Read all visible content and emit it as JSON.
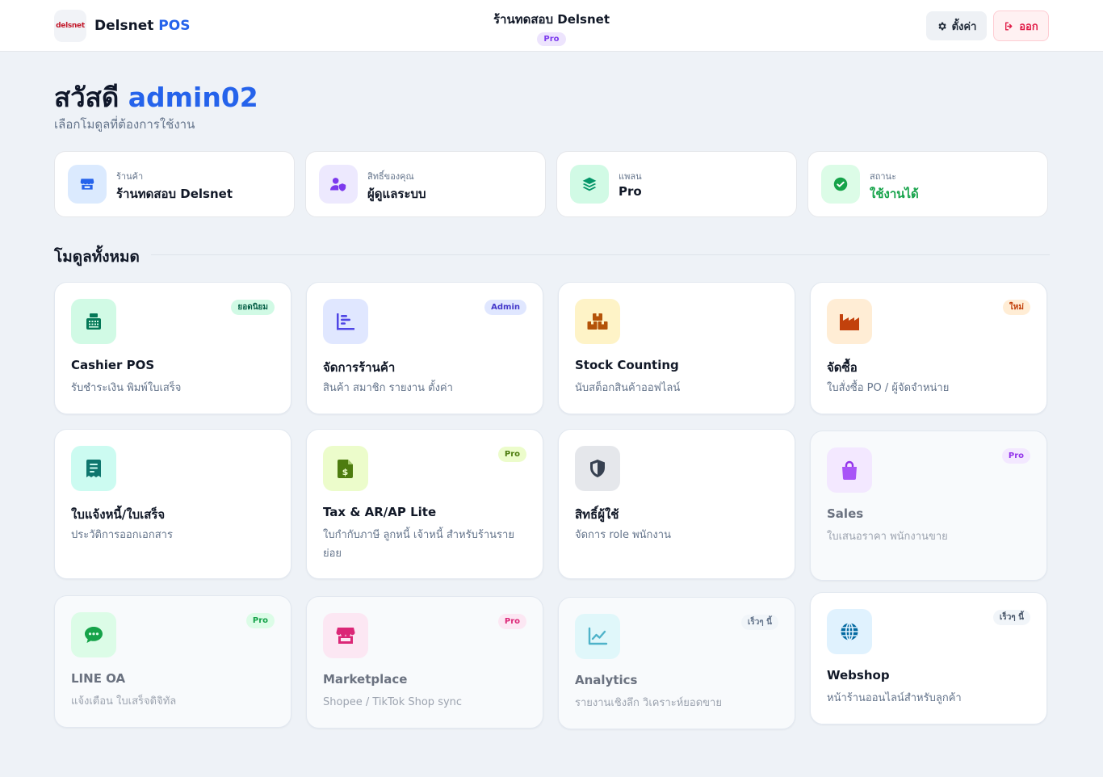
{
  "header": {
    "logo_text": "delsnet",
    "brand_name": "Delsnet",
    "brand_accent": "POS",
    "store_name": "ร้านทดสอบ Delsnet",
    "plan_badge": "Pro",
    "settings_label": "ตั้งค่า",
    "logout_label": "ออก"
  },
  "greeting": {
    "prefix": "สวัสดี",
    "username": "admin02",
    "subtitle": "เลือกโมดูลที่ต้องการใช้งาน"
  },
  "info_cards": [
    {
      "label": "ร้านค้า",
      "value": "ร้านทดสอบ Delsnet",
      "icon": "store-icon",
      "color": "#2563eb"
    },
    {
      "label": "สิทธิ์ของคุณ",
      "value": "ผู้ดูแลระบบ",
      "icon": "user-shield-icon",
      "color": "#7c3aed"
    },
    {
      "label": "แพลน",
      "value": "Pro",
      "icon": "layers-icon",
      "color": "#059669"
    },
    {
      "label": "สถานะ",
      "value": "ใช้งานได้",
      "icon": "check-circle-icon",
      "color": "#16a34a"
    }
  ],
  "section_title": "โมดูลทั้งหมด",
  "modules": [
    {
      "title": "Cashier POS",
      "desc": "รับชำระเงิน พิมพ์ใบเสร็จ",
      "badge": "ยอดนิยม",
      "icon": "cash-register-icon"
    },
    {
      "title": "จัดการร้านค้า",
      "desc": "สินค้า สมาชิก รายงาน ตั้งค่า",
      "badge": "Admin",
      "icon": "chart-bars-icon"
    },
    {
      "title": "Stock Counting",
      "desc": "นับสต็อกสินค้าออฟไลน์",
      "badge": "",
      "icon": "boxes-icon"
    },
    {
      "title": "จัดซื้อ",
      "desc": "ใบสั่งซื้อ PO / ผู้จัดจำหน่าย",
      "badge": "ใหม่",
      "icon": "factory-icon"
    },
    {
      "title": "ใบแจ้งหนี้/ใบเสร็จ",
      "desc": "ประวัติการออกเอกสาร",
      "badge": "",
      "icon": "receipt-icon"
    },
    {
      "title": "Tax & AR/AP Lite",
      "desc": "ใบกำกับภาษี ลูกหนี้ เจ้าหนี้ สำหรับร้านรายย่อย",
      "badge": "Pro",
      "icon": "invoice-dollar-icon"
    },
    {
      "title": "สิทธิ์ผู้ใช้",
      "desc": "จัดการ role พนักงาน",
      "badge": "",
      "icon": "shield-icon"
    },
    {
      "title": "Sales",
      "desc": "ใบเสนอราคา พนักงานขาย",
      "badge": "Pro",
      "icon": "shopping-bag-icon"
    },
    {
      "title": "LINE OA",
      "desc": "แจ้งเตือน ใบเสร็จดิจิทัล",
      "badge": "Pro",
      "icon": "chat-bubble-icon"
    },
    {
      "title": "Marketplace",
      "desc": "Shopee / TikTok Shop sync",
      "badge": "Pro",
      "icon": "shop-icon"
    },
    {
      "title": "Analytics",
      "desc": "รายงานเชิงลึก วิเคราะห์ยอดขาย",
      "badge": "เร็วๆ นี้",
      "icon": "line-chart-icon"
    },
    {
      "title": "Webshop",
      "desc": "หน้าร้านออนไลน์สำหรับลูกค้า",
      "badge": "เร็วๆ นี้",
      "icon": "globe-icon"
    }
  ]
}
